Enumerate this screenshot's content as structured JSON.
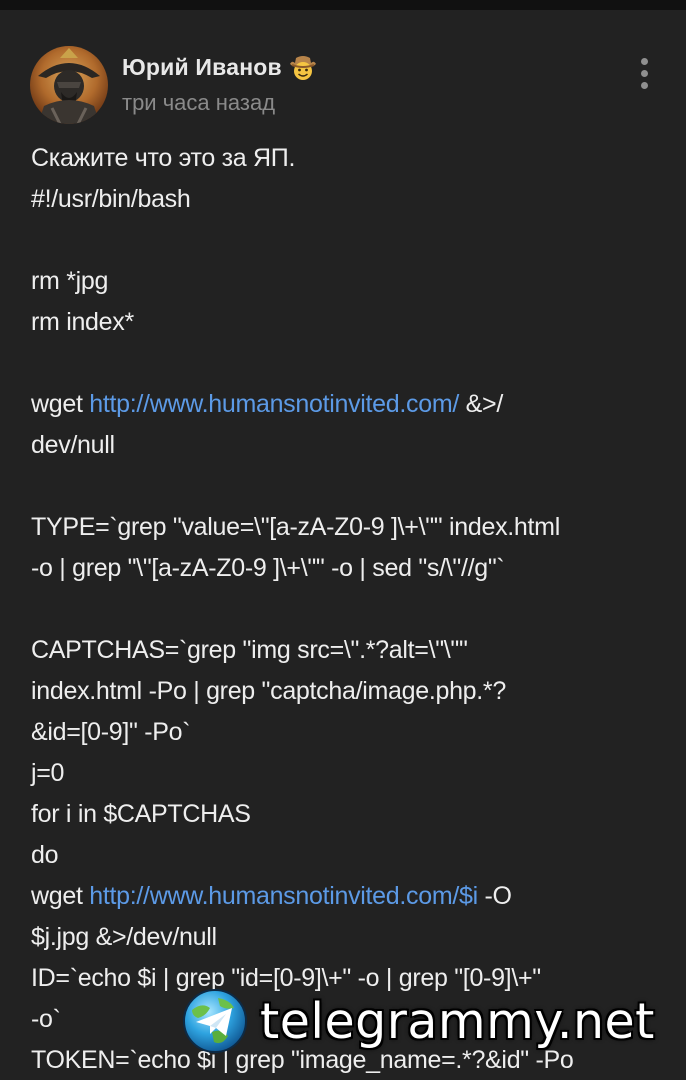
{
  "post": {
    "author_name": "Юрий Иванов",
    "author_badge_icon": "cowboy-emoji-icon",
    "time": "три часа назад",
    "more_icon": "vertical-dots-icon",
    "lines": [
      {
        "segments": [
          {
            "text": "Скажите что это за ЯП."
          }
        ]
      },
      {
        "segments": [
          {
            "text": "#!/usr/bin/bash"
          }
        ]
      },
      {
        "segments": [
          {
            "text": ""
          }
        ]
      },
      {
        "segments": [
          {
            "text": "rm *jpg"
          }
        ]
      },
      {
        "segments": [
          {
            "text": "rm index*"
          }
        ]
      },
      {
        "segments": [
          {
            "text": ""
          }
        ]
      },
      {
        "segments": [
          {
            "text": "wget "
          },
          {
            "text": "http://www.humansnotinvited.com/",
            "link": true
          },
          {
            "text": " &>/"
          }
        ]
      },
      {
        "segments": [
          {
            "text": "dev/null"
          }
        ]
      },
      {
        "segments": [
          {
            "text": ""
          }
        ]
      },
      {
        "segments": [
          {
            "text": "TYPE=`grep \"value=\\\"[a-zA-Z0-9 ]\\+\\\"\" index.html"
          }
        ]
      },
      {
        "segments": [
          {
            "text": "-o | grep \"\\\"[a-zA-Z0-9 ]\\+\\\"\" -o | sed \"s/\\\"//g\"`"
          }
        ]
      },
      {
        "segments": [
          {
            "text": ""
          }
        ]
      },
      {
        "segments": [
          {
            "text": "CAPTCHAS=`grep \"img src=\\\".*?alt=\\\"\\\"\""
          }
        ]
      },
      {
        "segments": [
          {
            "text": "index.html -Po | grep \"captcha/image.php.*?"
          }
        ]
      },
      {
        "segments": [
          {
            "text": "&id=[0-9]\" -Po`"
          }
        ]
      },
      {
        "segments": [
          {
            "text": "j=0"
          }
        ]
      },
      {
        "segments": [
          {
            "text": "for i in $CAPTCHAS"
          }
        ]
      },
      {
        "segments": [
          {
            "text": "do"
          }
        ]
      },
      {
        "segments": [
          {
            "text": " wget "
          },
          {
            "text": "http://www.humansnotinvited.com/$i",
            "link": true
          },
          {
            "text": " -O"
          }
        ]
      },
      {
        "segments": [
          {
            "text": "$j.jpg &>/dev/null"
          }
        ]
      },
      {
        "segments": [
          {
            "text": " ID=`echo $i | grep \"id=[0-9]\\+\" -o | grep \"[0-9]\\+\""
          }
        ]
      },
      {
        "segments": [
          {
            "text": "-o`"
          }
        ]
      },
      {
        "segments": [
          {
            "text": " TOKEN=`echo $i | grep \"image_name=.*?&id\" -Po"
          }
        ]
      }
    ]
  },
  "watermark": {
    "text": "telegrammy.net",
    "icon": "telegram-globe-icon"
  },
  "colors": {
    "background": "#222222",
    "text": "#eeeeee",
    "link": "#5c9ae6",
    "muted": "#8a8a8a"
  }
}
